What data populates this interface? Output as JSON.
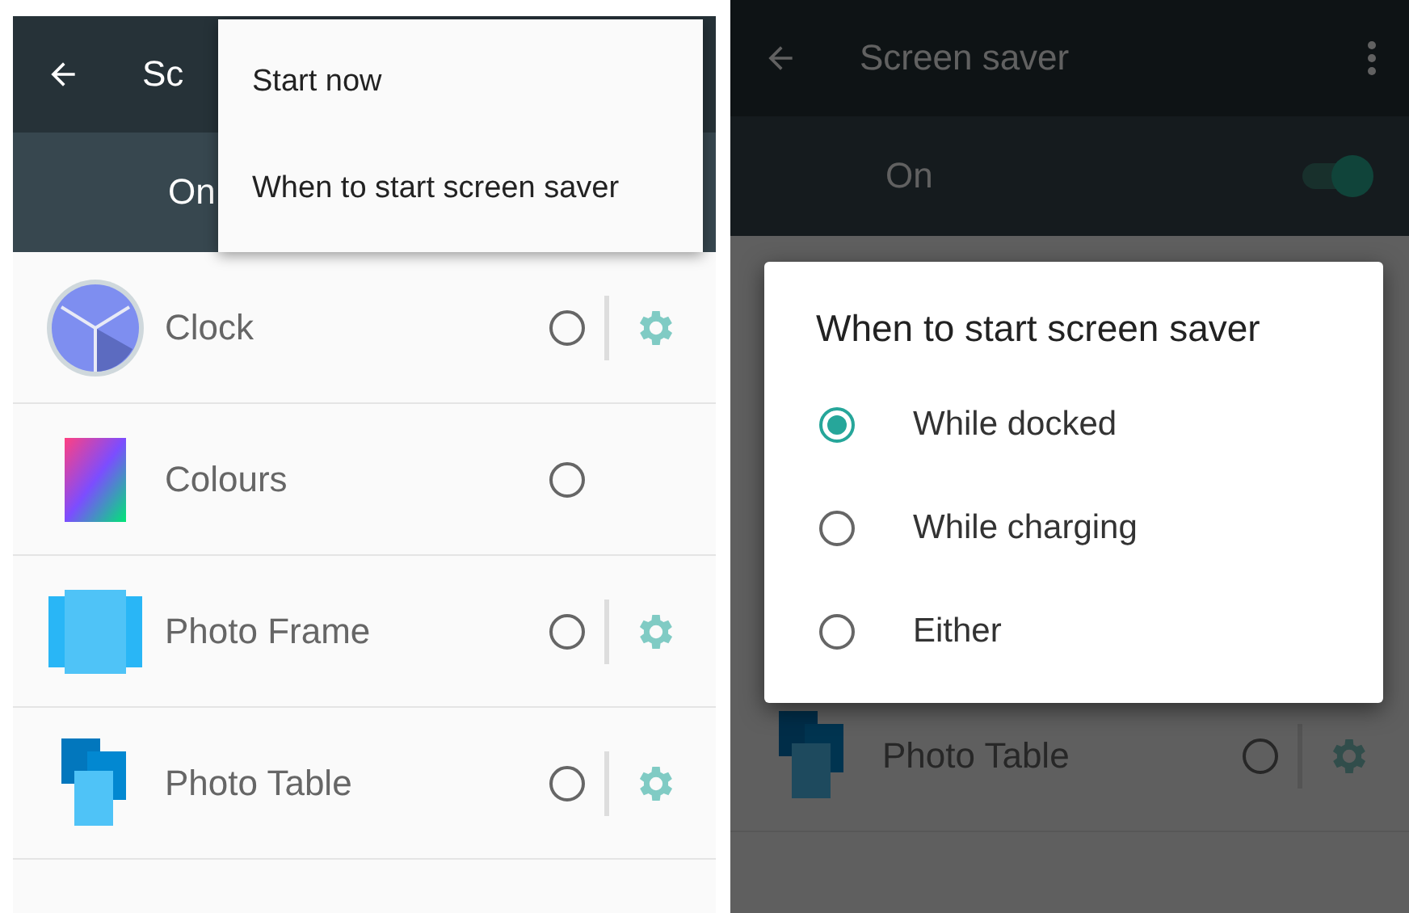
{
  "left_screen": {
    "toolbar": {
      "title": "Sc"
    },
    "master_switch": {
      "label": "On"
    },
    "menu": {
      "items": [
        "Start now",
        "When to start screen saver"
      ]
    },
    "savers": [
      {
        "kind": "clock",
        "name": "Clock",
        "selected": false,
        "settings": true
      },
      {
        "kind": "colours",
        "name": "Colours",
        "selected": false,
        "settings": false
      },
      {
        "kind": "frame",
        "name": "Photo Frame",
        "selected": false,
        "settings": true
      },
      {
        "kind": "table",
        "name": "Photo Table",
        "selected": false,
        "settings": true
      }
    ]
  },
  "right_screen": {
    "toolbar": {
      "title": "Screen saver"
    },
    "master_switch": {
      "label": "On",
      "on": true
    },
    "savers": [
      {
        "kind": "table",
        "name": "Photo Table",
        "selected": false,
        "settings": true
      }
    ],
    "dialog": {
      "title": "When to start screen saver",
      "options": [
        {
          "label": "While docked",
          "selected": true
        },
        {
          "label": "While charging",
          "selected": false
        },
        {
          "label": "Either",
          "selected": false
        }
      ]
    }
  }
}
